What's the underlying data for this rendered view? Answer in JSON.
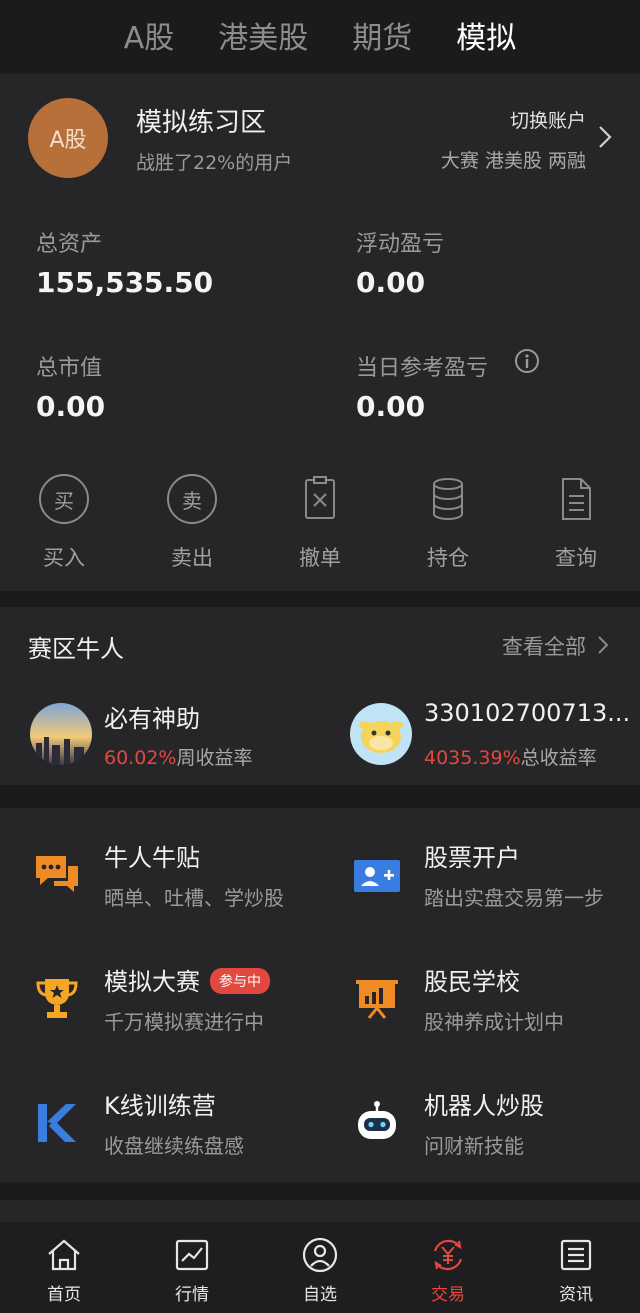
{
  "top_tabs": [
    {
      "label": "A股",
      "active": false
    },
    {
      "label": "港美股",
      "active": false
    },
    {
      "label": "期货",
      "active": false
    },
    {
      "label": "模拟",
      "active": true
    }
  ],
  "account": {
    "avatar_text": "A股",
    "title": "模拟练习区",
    "subtitle": "战胜了22%的用户",
    "switch_label": "切换账户",
    "switch_links": "大赛 港美股 两融"
  },
  "metrics": {
    "total_assets_label": "总资产",
    "total_assets_value": "155,535.50",
    "float_pl_label": "浮动盈亏",
    "float_pl_value": "0.00",
    "market_value_label": "总市值",
    "market_value_value": "0.00",
    "day_pl_label": "当日参考盈亏",
    "day_pl_value": "0.00"
  },
  "actions": [
    {
      "label": "买入",
      "icon_text": "买"
    },
    {
      "label": "卖出",
      "icon_text": "卖"
    },
    {
      "label": "撤单"
    },
    {
      "label": "持仓"
    },
    {
      "label": "查询"
    }
  ],
  "leaders": {
    "title": "赛区牛人",
    "see_all": "查看全部",
    "items": [
      {
        "name": "必有神助",
        "pct": "60.02%",
        "rate_label": "周收益率"
      },
      {
        "name": "330102700713...",
        "pct": "4035.39%",
        "rate_label": "总收益率"
      }
    ]
  },
  "features": [
    {
      "title": "牛人牛贴",
      "sub": "晒单、吐槽、学炒股",
      "icon": "chat-bubbles-icon"
    },
    {
      "title": "股票开户",
      "sub": "踏出实盘交易第一步",
      "icon": "add-user-card-icon"
    },
    {
      "title": "模拟大赛",
      "sub": "千万模拟赛进行中",
      "badge": "参与中",
      "icon": "trophy-icon"
    },
    {
      "title": "股民学校",
      "sub": "股神养成计划中",
      "icon": "presentation-board-icon"
    },
    {
      "title": "K线训练营",
      "sub": "收盘继续练盘感",
      "icon": "k-letter-icon"
    },
    {
      "title": "机器人炒股",
      "sub": "问财新技能",
      "icon": "robot-icon"
    }
  ],
  "bottom_nav": [
    {
      "label": "首页",
      "active": false
    },
    {
      "label": "行情",
      "active": false
    },
    {
      "label": "自选",
      "active": false
    },
    {
      "label": "交易",
      "active": true
    },
    {
      "label": "资讯",
      "active": false
    }
  ],
  "colors": {
    "background": "#1b1b1d",
    "card": "#262628",
    "accent_red": "#e2483e",
    "avatar_orange": "#b8703a",
    "icon_orange": "#f08a24",
    "icon_blue": "#3a7de0"
  }
}
